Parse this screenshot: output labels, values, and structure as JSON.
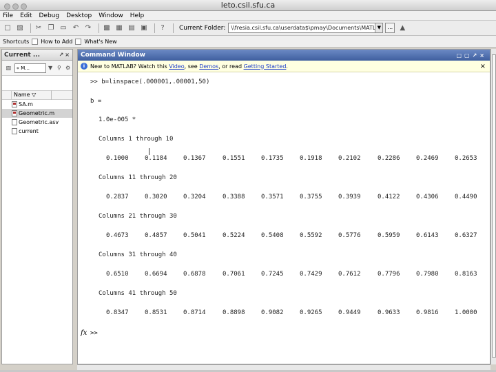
{
  "window": {
    "title": "leto.csil.sfu.ca"
  },
  "menu": [
    "File",
    "Edit",
    "Debug",
    "Desktop",
    "Window",
    "Help"
  ],
  "toolbar": {
    "current_folder_label": "Current Folder:",
    "current_folder_value": "\\\\fresia.csil.sfu.ca\\userdata$\\pmay\\Documents\\MATLAB",
    "browse_label": "..."
  },
  "shortcuts": {
    "label": "Shortcuts",
    "how_to_add": "How to Add",
    "whats_new": "What's New"
  },
  "left_panel": {
    "title": "Current ...",
    "path_combo": "« M...",
    "column_name": "Name ▽",
    "files": [
      {
        "name": "SA.m",
        "selected": false
      },
      {
        "name": "Geometric.m",
        "selected": true
      },
      {
        "name": "Geometric.asv",
        "selected": false
      },
      {
        "name": "current",
        "selected": false
      }
    ]
  },
  "command_window": {
    "title": "Command Window",
    "info": {
      "prefix": "New to MATLAB? Watch this ",
      "video": "Video",
      "mid1": ", see ",
      "demos": "Demos",
      "mid2": ", or read ",
      "getting_started": "Getting Started",
      "suffix": "."
    },
    "command": ">> b=linspace(.000001,.00001,50)",
    "result_var": "b =",
    "scale": "1.0e-005 *",
    "blocks": [
      {
        "header": "Columns 1 through 10",
        "values": [
          "0.1000",
          "0.1184",
          "0.1367",
          "0.1551",
          "0.1735",
          "0.1918",
          "0.2102",
          "0.2286",
          "0.2469",
          "0.2653"
        ]
      },
      {
        "header": "Columns 11 through 20",
        "values": [
          "0.2837",
          "0.3020",
          "0.3204",
          "0.3388",
          "0.3571",
          "0.3755",
          "0.3939",
          "0.4122",
          "0.4306",
          "0.4490"
        ]
      },
      {
        "header": "Columns 21 through 30",
        "values": [
          "0.4673",
          "0.4857",
          "0.5041",
          "0.5224",
          "0.5408",
          "0.5592",
          "0.5776",
          "0.5959",
          "0.6143",
          "0.6327"
        ]
      },
      {
        "header": "Columns 31 through 40",
        "values": [
          "0.6510",
          "0.6694",
          "0.6878",
          "0.7061",
          "0.7245",
          "0.7429",
          "0.7612",
          "0.7796",
          "0.7980",
          "0.8163"
        ]
      },
      {
        "header": "Columns 41 through 50",
        "values": [
          "0.8347",
          "0.8531",
          "0.8714",
          "0.8898",
          "0.9082",
          "0.9265",
          "0.9449",
          "0.9633",
          "0.9816",
          "1.0000"
        ]
      }
    ],
    "fx_label": "fx",
    "prompt": ">>"
  }
}
